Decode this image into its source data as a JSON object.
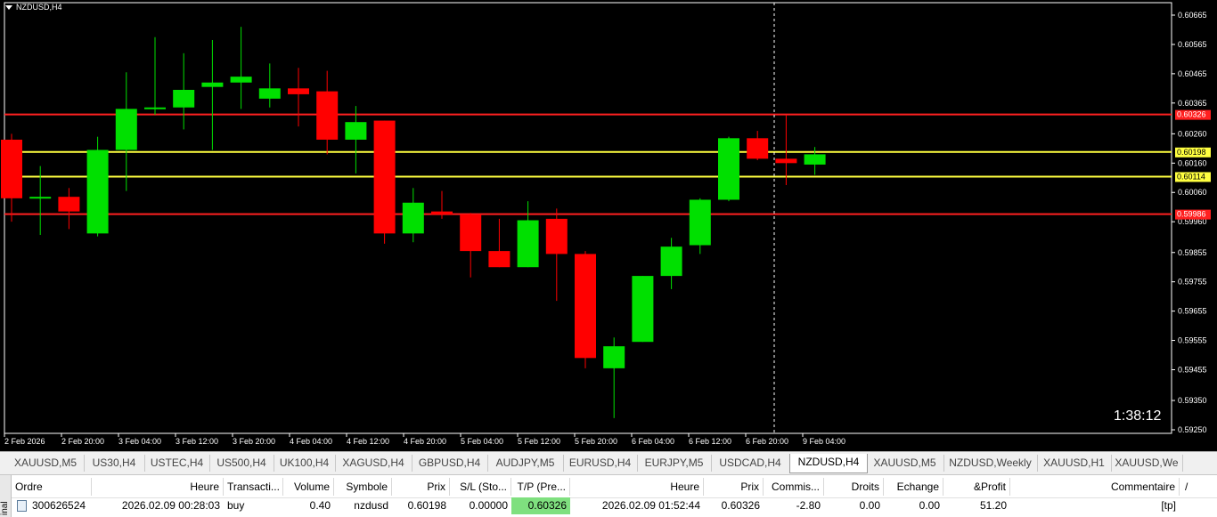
{
  "chart": {
    "symbol_label": "NZDUSD,H4",
    "countdown": "1:38:12",
    "price_ticks": [
      "0.60665",
      "0.60565",
      "0.60465",
      "0.60365",
      "0.60260",
      "0.60160",
      "0.60060",
      "0.59960",
      "0.59855",
      "0.59755",
      "0.59655",
      "0.59555",
      "0.59455",
      "0.59350",
      "0.59250"
    ],
    "time_ticks": [
      "2 Feb 2026",
      "2 Feb 20:00",
      "3 Feb 04:00",
      "3 Feb 12:00",
      "3 Feb 20:00",
      "4 Feb 04:00",
      "4 Feb 12:00",
      "4 Feb 20:00",
      "5 Feb 04:00",
      "5 Feb 12:00",
      "5 Feb 20:00",
      "6 Feb 04:00",
      "6 Feb 12:00",
      "6 Feb 20:00",
      "9 Feb 04:00"
    ],
    "hlines": [
      {
        "price": 0.60326,
        "label": "0.60326",
        "color": "#ff2020"
      },
      {
        "price": 0.60198,
        "label": "0.60198",
        "color": "#ffff40"
      },
      {
        "price": 0.60114,
        "label": "0.60114",
        "color": "#ffff40"
      },
      {
        "price": 0.59986,
        "label": "0.59986",
        "color": "#ff2020"
      }
    ],
    "bull_color": "#00e000",
    "bear_color": "#ff0000",
    "candles": [
      {
        "o": 0.6024,
        "h": 0.6026,
        "l": 0.5996,
        "c": 0.6004
      },
      {
        "o": 0.6004,
        "h": 0.6015,
        "l": 0.59915,
        "c": 0.60045
      },
      {
        "o": 0.60045,
        "h": 0.60075,
        "l": 0.59935,
        "c": 0.59995
      },
      {
        "o": 0.5992,
        "h": 0.6025,
        "l": 0.5991,
        "c": 0.60205
      },
      {
        "o": 0.60205,
        "h": 0.6047,
        "l": 0.60065,
        "c": 0.60345
      },
      {
        "o": 0.60345,
        "h": 0.6059,
        "l": 0.60325,
        "c": 0.6035
      },
      {
        "o": 0.6035,
        "h": 0.60535,
        "l": 0.60275,
        "c": 0.6041
      },
      {
        "o": 0.6042,
        "h": 0.6058,
        "l": 0.60205,
        "c": 0.60435
      },
      {
        "o": 0.60435,
        "h": 0.60625,
        "l": 0.60345,
        "c": 0.60455
      },
      {
        "o": 0.6038,
        "h": 0.605,
        "l": 0.6035,
        "c": 0.60415
      },
      {
        "o": 0.60415,
        "h": 0.60485,
        "l": 0.60285,
        "c": 0.60395
      },
      {
        "o": 0.60405,
        "h": 0.60475,
        "l": 0.6019,
        "c": 0.6024
      },
      {
        "o": 0.6024,
        "h": 0.60355,
        "l": 0.60125,
        "c": 0.603
      },
      {
        "o": 0.60305,
        "h": 0.60305,
        "l": 0.59885,
        "c": 0.5992
      },
      {
        "o": 0.5992,
        "h": 0.60075,
        "l": 0.5989,
        "c": 0.60025
      },
      {
        "o": 0.59995,
        "h": 0.60065,
        "l": 0.5997,
        "c": 0.59985
      },
      {
        "o": 0.59985,
        "h": 0.5999,
        "l": 0.5977,
        "c": 0.5986
      },
      {
        "o": 0.5986,
        "h": 0.5997,
        "l": 0.59805,
        "c": 0.59805
      },
      {
        "o": 0.59805,
        "h": 0.6003,
        "l": 0.59805,
        "c": 0.59965
      },
      {
        "o": 0.5997,
        "h": 0.60005,
        "l": 0.5969,
        "c": 0.5985
      },
      {
        "o": 0.5985,
        "h": 0.5986,
        "l": 0.5946,
        "c": 0.59495
      },
      {
        "o": 0.5946,
        "h": 0.59565,
        "l": 0.5929,
        "c": 0.59535
      },
      {
        "o": 0.5955,
        "h": 0.59775,
        "l": 0.5955,
        "c": 0.59775
      },
      {
        "o": 0.59775,
        "h": 0.59905,
        "l": 0.5973,
        "c": 0.59875
      },
      {
        "o": 0.5988,
        "h": 0.6004,
        "l": 0.5985,
        "c": 0.60035
      },
      {
        "o": 0.60035,
        "h": 0.6025,
        "l": 0.6003,
        "c": 0.60245
      },
      {
        "o": 0.60245,
        "h": 0.6027,
        "l": 0.6017,
        "c": 0.60175
      },
      {
        "o": 0.60175,
        "h": 0.60325,
        "l": 0.60085,
        "c": 0.6016
      },
      {
        "o": 0.60155,
        "h": 0.60215,
        "l": 0.6012,
        "c": 0.6019
      }
    ]
  },
  "tabs": [
    "XAUUSD,M5",
    "US30,H4",
    "USTEC,H4",
    "US500,H4",
    "UK100,H4",
    "XAGUSD,H4",
    "GBPUSD,H4",
    "AUDJPY,M5",
    "EURUSD,H4",
    "EURJPY,M5",
    "USDCAD,H4",
    "NZDUSD,H4",
    "XAUUSD,M5",
    "NZDUSD,Weekly",
    "XAUUSD,H1",
    "XAUUSD,We"
  ],
  "active_tab": "NZDUSD,H4",
  "terminal": {
    "side_label": "inal",
    "headers": [
      "Ordre",
      "Heure",
      "Transacti...",
      "Volume",
      "Symbole",
      "Prix",
      "S/L (Sto...",
      "T/P (Pre...",
      "Heure",
      "Prix",
      "Commis...",
      "Droits",
      "Echange",
      "&Profit",
      "Commentaire"
    ],
    "row": [
      "300626524",
      "2026.02.09 00:28:03",
      "buy",
      "0.40",
      "nzdusd",
      "0.60198",
      "0.00000",
      "0.60326",
      "2026.02.09 01:52:44",
      "0.60326",
      "-2.80",
      "0.00",
      "0.00",
      "51.20",
      "[tp]"
    ],
    "sort_marker": "/"
  }
}
